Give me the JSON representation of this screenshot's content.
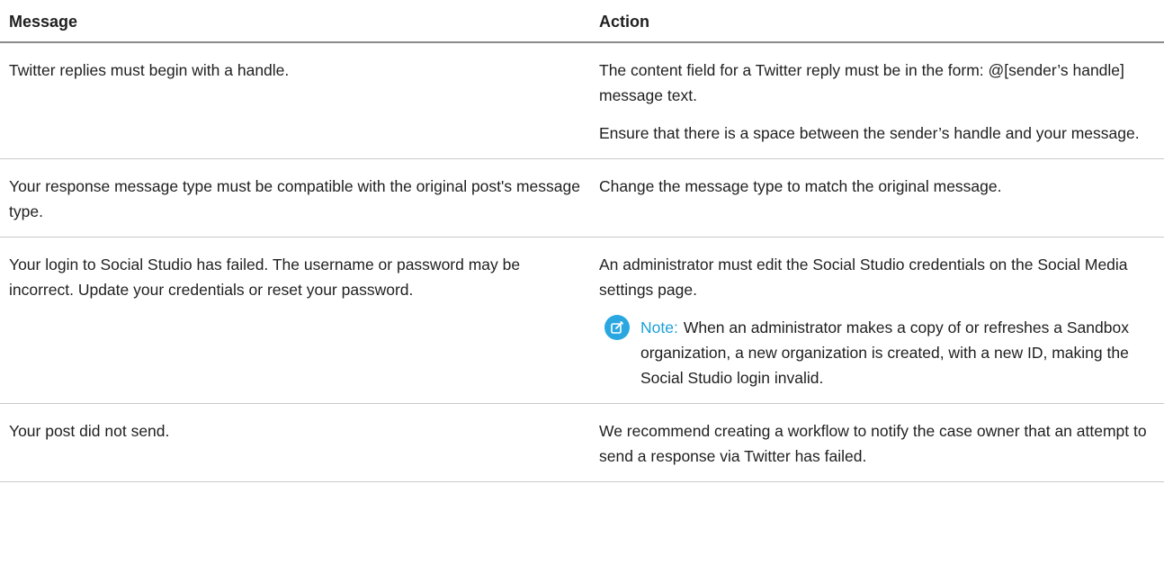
{
  "table": {
    "headers": {
      "message": "Message",
      "action": "Action"
    },
    "rows": [
      {
        "message": "Twitter replies must begin with a handle.",
        "action": [
          "The content field for a Twitter reply must be in the form: @[sender’s handle] message text.",
          "Ensure that there is a space between the sender’s handle and your message."
        ]
      },
      {
        "message": "Your response message type must be compatible with the original post's message type.",
        "action": [
          "Change the message type to match the original message."
        ]
      },
      {
        "message": "Your login to Social Studio has failed. The username or password may be incorrect. Update your credentials or reset your password.",
        "action": [
          "An administrator must edit the Social Studio credentials on the Social Media settings page."
        ],
        "note": {
          "icon": "edit-note-icon",
          "label": "Note:",
          "text": "When an administrator makes a copy of or refreshes a Sandbox organization, a new organization is created, with a new ID, making the Social Studio login invalid."
        }
      },
      {
        "message": "Your post did not send.",
        "action": [
          "We recommend creating a workflow to notify the case owner that an attempt to send a response via Twitter has failed."
        ]
      }
    ]
  },
  "colors": {
    "note_accent": "#2aa7e0",
    "header_rule": "#8a8a8a",
    "row_rule": "#c9c9c9"
  }
}
